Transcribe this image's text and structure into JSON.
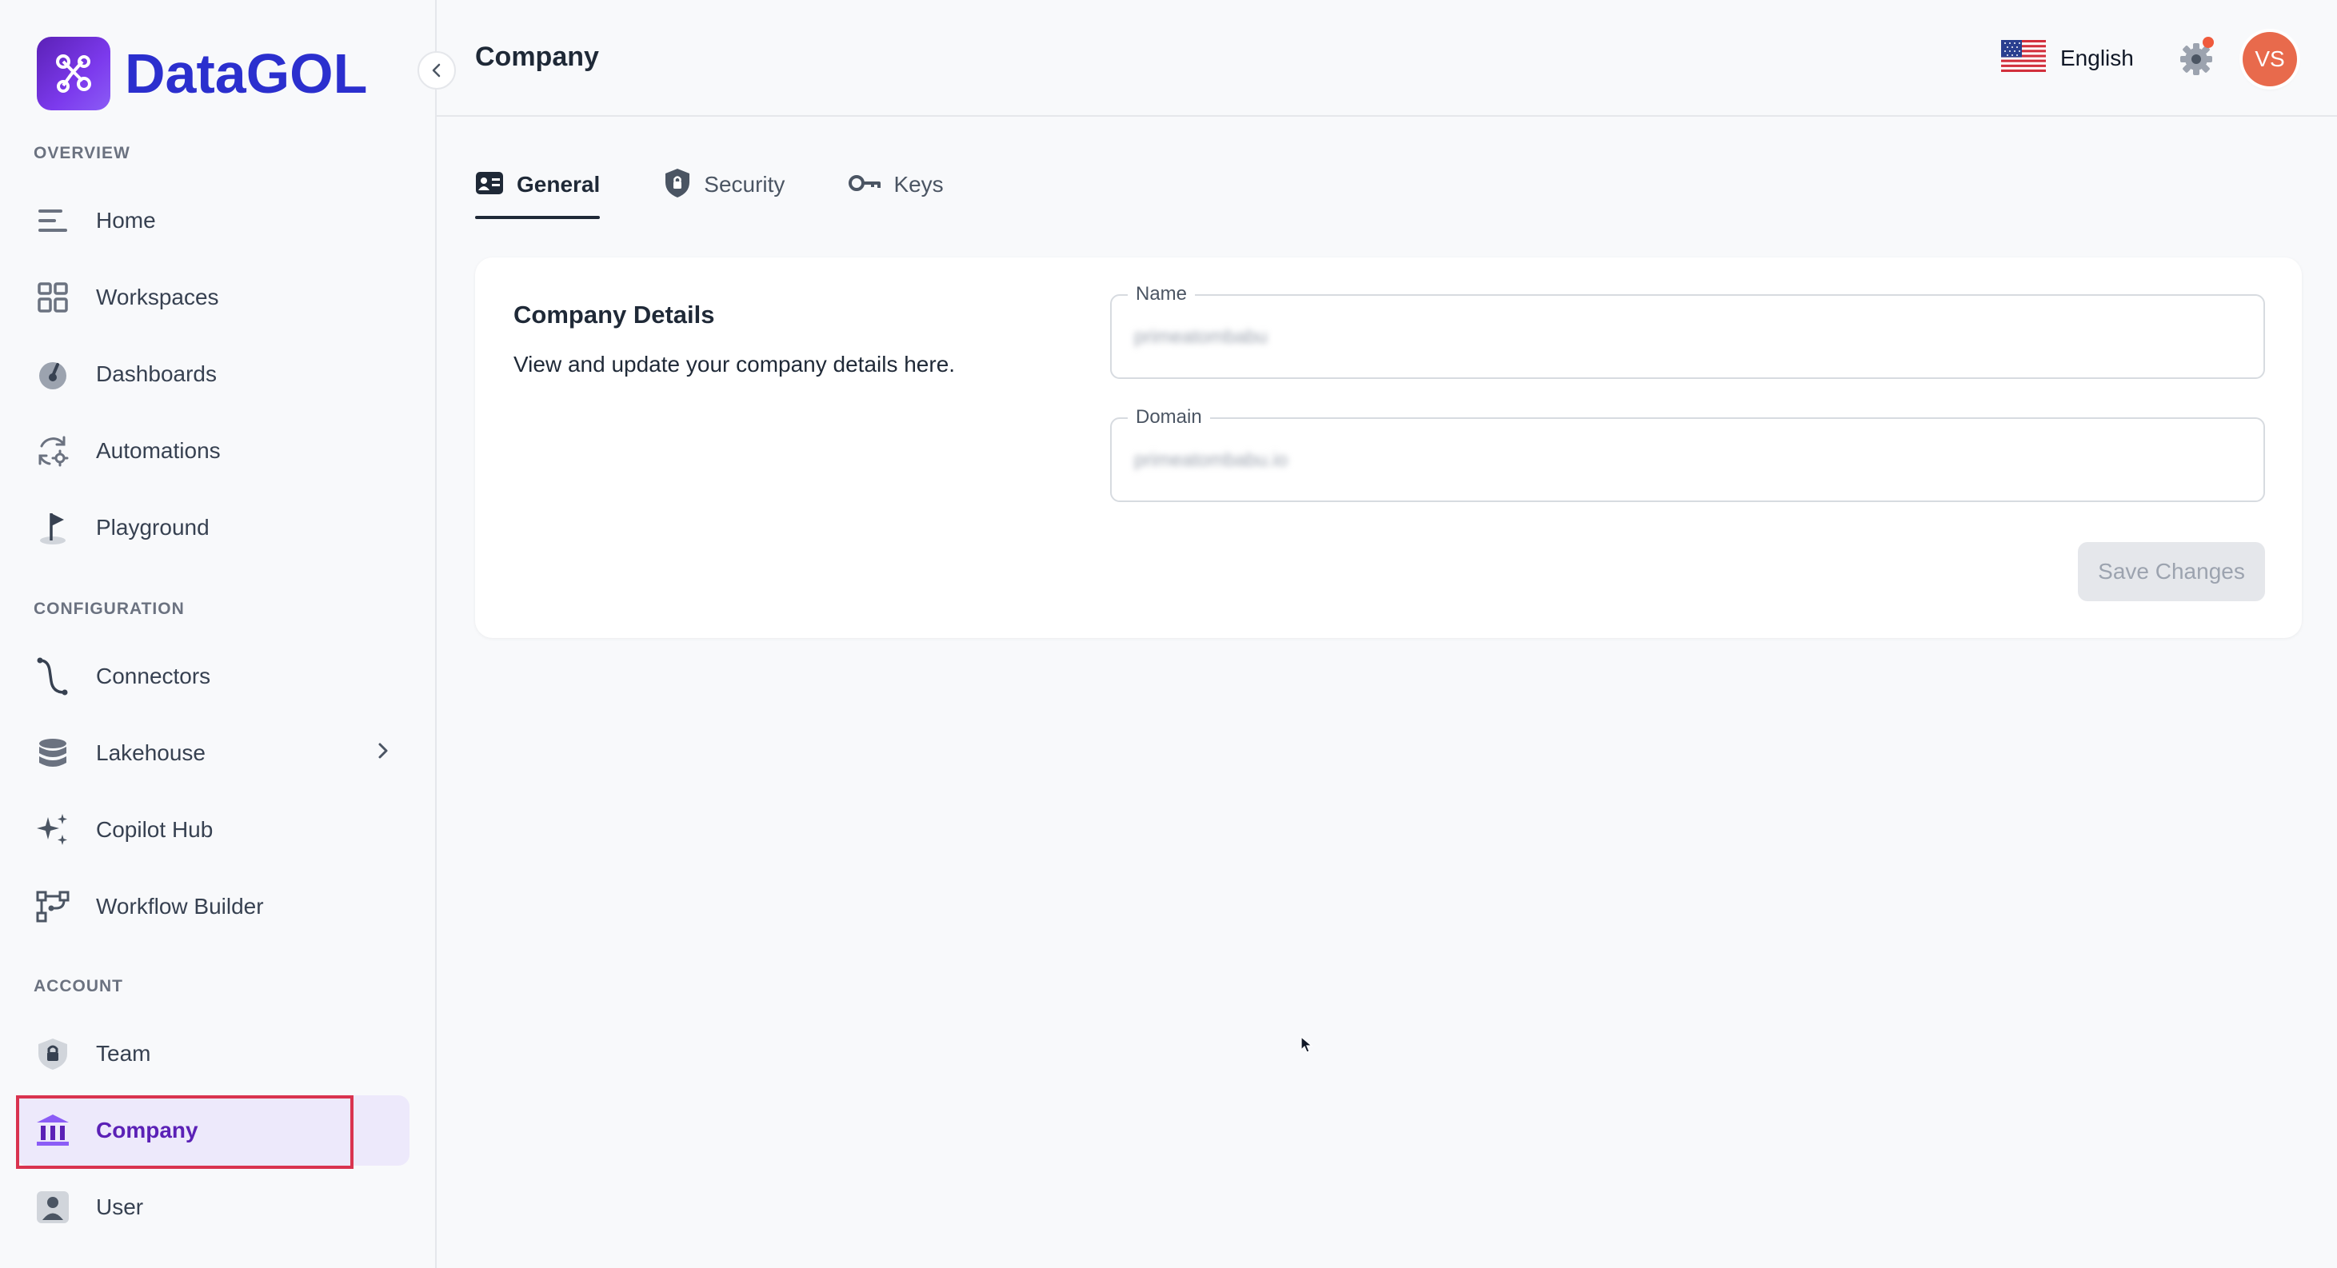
{
  "brand": {
    "name": "DataGOL"
  },
  "sidebar": {
    "sections": {
      "overview": "OVERVIEW",
      "configuration": "CONFIGURATION",
      "account": "ACCOUNT"
    },
    "items": [
      {
        "label": "Home",
        "icon": "home-lines-icon"
      },
      {
        "label": "Workspaces",
        "icon": "grid-icon"
      },
      {
        "label": "Dashboards",
        "icon": "gauge-icon"
      },
      {
        "label": "Automations",
        "icon": "refresh-gear-icon"
      },
      {
        "label": "Playground",
        "icon": "flag-icon"
      },
      {
        "label": "Connectors",
        "icon": "connector-icon"
      },
      {
        "label": "Lakehouse",
        "icon": "database-icon"
      },
      {
        "label": "Copilot Hub",
        "icon": "sparkles-icon"
      },
      {
        "label": "Workflow Builder",
        "icon": "workflow-icon"
      },
      {
        "label": "Team",
        "icon": "lock-badge-icon"
      },
      {
        "label": "Company",
        "icon": "bank-icon",
        "active": true
      },
      {
        "label": "User",
        "icon": "user-icon"
      }
    ]
  },
  "header": {
    "title": "Company",
    "language": "English",
    "avatar_initials": "VS"
  },
  "tabs": [
    {
      "label": "General",
      "icon": "id-card-icon",
      "active": true
    },
    {
      "label": "Security",
      "icon": "shield-icon"
    },
    {
      "label": "Keys",
      "icon": "key-icon"
    }
  ],
  "company_details": {
    "title": "Company Details",
    "description": "View and update your company details here.",
    "name_label": "Name",
    "name_value": "primeatombabu",
    "domain_label": "Domain",
    "domain_value": "primeatombabu.io",
    "save_label": "Save Changes"
  },
  "colors": {
    "brand": "#2b2fce",
    "accent": "#5b21b6",
    "active_bg": "#ede9fb",
    "highlight_outline": "#d9334f",
    "avatar": "#e86a4c"
  }
}
